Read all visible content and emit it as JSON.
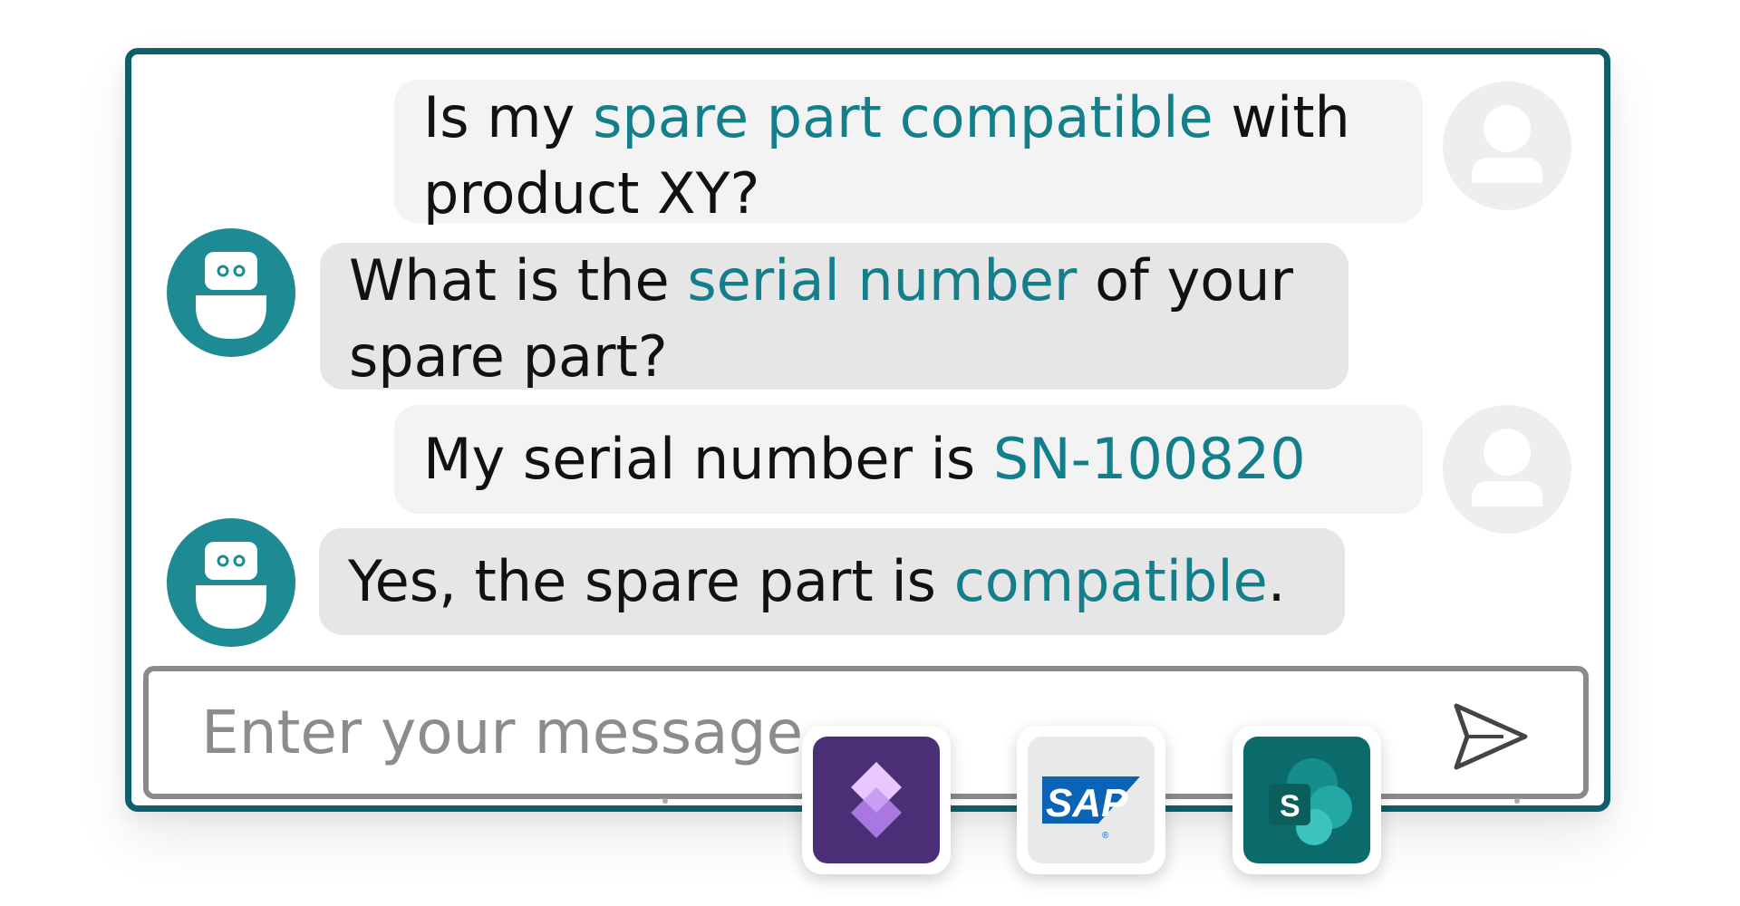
{
  "conversation": {
    "m1": {
      "before": "Is my ",
      "highlight": "spare part compatible",
      "after": " with product XY?"
    },
    "m2": {
      "before": "What is the ",
      "highlight": "serial number",
      "after": " of your spare part?"
    },
    "m3": {
      "before": "My serial number is ",
      "highlight": "SN-100820",
      "after": ""
    },
    "m4": {
      "before": "Yes, the spare part is ",
      "highlight": "compatible",
      "after": "."
    }
  },
  "input": {
    "placeholder": "Enter your message"
  },
  "integrations": {
    "sap_label": "SAP",
    "sharepoint_label": "S"
  },
  "icons": {
    "send": "send-icon",
    "user": "user-avatar-icon",
    "bot": "bot-avatar-icon",
    "power_automate": "power-automate-icon",
    "sap": "sap-logo-icon",
    "sharepoint": "sharepoint-icon"
  },
  "colors": {
    "frame": "#0f5e6b",
    "highlight": "#137f8b",
    "bot_avatar": "#1e8b94",
    "user_bubble": "#f3f3f3",
    "bot_bubble": "#e6e6e6"
  }
}
